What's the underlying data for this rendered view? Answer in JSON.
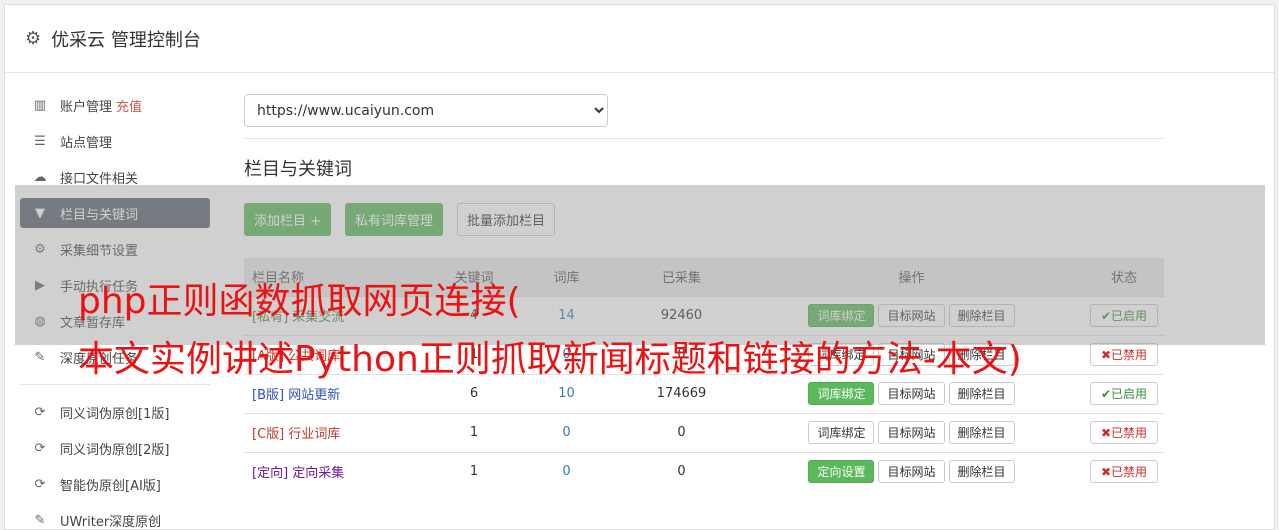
{
  "header": {
    "title": "优采云 管理控制台"
  },
  "sidebar": {
    "items": [
      {
        "icon": "bar-chart-icon",
        "label": "账户管理",
        "extra": "充值"
      },
      {
        "icon": "server-icon",
        "label": "站点管理"
      },
      {
        "icon": "cloud-upload-icon",
        "label": "接口文件相关"
      },
      {
        "icon": "filter-icon",
        "label": "栏目与关键词",
        "active": true
      },
      {
        "icon": "cogs-icon",
        "label": "采集细节设置"
      },
      {
        "icon": "play-circle-icon",
        "label": "手动执行任务"
      },
      {
        "icon": "database-icon",
        "label": "文章暂存库"
      },
      {
        "icon": "edit-icon",
        "label": "深度原创任务"
      }
    ],
    "items2": [
      {
        "icon": "refresh-icon",
        "label": "同义词伪原创[1版]"
      },
      {
        "icon": "refresh-icon",
        "label": "同义词伪原创[2版]"
      },
      {
        "icon": "refresh-icon",
        "label": "智能伪原创[AI版]"
      },
      {
        "icon": "edit-icon",
        "label": "UWriter深度原创"
      }
    ]
  },
  "main": {
    "site_select": "https://www.ucaiyun.com",
    "section_title": "栏目与关键词",
    "buttons": {
      "add": "添加栏目 +",
      "private": "私有词库管理",
      "batch": "批量添加栏目"
    },
    "table": {
      "headers": [
        "栏目名称",
        "关键词",
        "词库",
        "已采集",
        "操作",
        "状态"
      ],
      "rows": [
        {
          "name": "[私有] 采集交流",
          "cls": "t-green",
          "a": "4",
          "b": "14",
          "c": "92460",
          "op1": "词库绑定",
          "op1_green": true,
          "op2": "目标网站",
          "op3": "删除栏目",
          "status": "✔已启用",
          "on": true
        },
        {
          "name": "[A版] 公共词库",
          "cls": "t-red",
          "a": "1",
          "b": "0",
          "c": "0",
          "op1": "词库绑定",
          "op1_green": false,
          "op2": "目标网站",
          "op3": "删除栏目",
          "status": "✖已禁用",
          "on": false
        },
        {
          "name": "[B版] 网站更新",
          "cls": "t-blue",
          "a": "6",
          "b": "10",
          "c": "174669",
          "op1": "词库绑定",
          "op1_green": true,
          "op2": "目标网站",
          "op3": "删除栏目",
          "status": "✔已启用",
          "on": true
        },
        {
          "name": "[C版] 行业词库",
          "cls": "t-red",
          "a": "1",
          "b": "0",
          "c": "0",
          "op1": "词库绑定",
          "op1_green": false,
          "op2": "目标网站",
          "op3": "删除栏目",
          "status": "✖已禁用",
          "on": false
        },
        {
          "name": "[定向] 定向采集",
          "cls": "t-purple",
          "a": "1",
          "b": "0",
          "c": "0",
          "op1": "定向设置",
          "op1_green": true,
          "op2": "目标网站",
          "op3": "删除栏目",
          "status": "✖已禁用",
          "on": false
        }
      ]
    }
  },
  "overlay": {
    "line1": "php正则函数抓取网页连接(",
    "line2": "本文实例讲述Python正则抓取新闻标题和链接的方法-本文)"
  }
}
